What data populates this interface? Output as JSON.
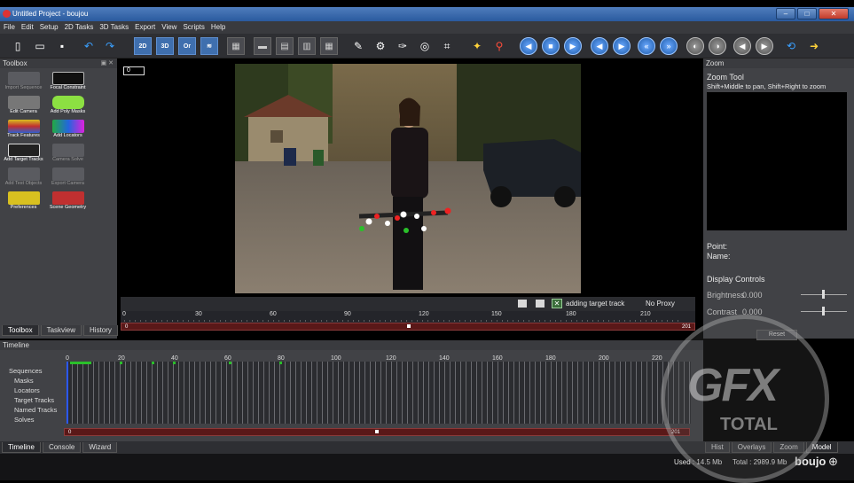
{
  "window": {
    "title": "Untitled Project - boujou"
  },
  "menu": [
    "File",
    "Edit",
    "Setup",
    "2D Tasks",
    "3D Tasks",
    "Export",
    "View",
    "Scripts",
    "Help"
  ],
  "toolbox": {
    "header": "Toolbox",
    "tools": [
      {
        "label": "Import Sequence",
        "enabled": false
      },
      {
        "label": "Focal Constraint",
        "enabled": true
      },
      {
        "label": "Edit Camera",
        "enabled": true
      },
      {
        "label": "Add Poly Masks",
        "enabled": true
      },
      {
        "label": "Track Features",
        "enabled": true
      },
      {
        "label": "Add Locators",
        "enabled": true
      },
      {
        "label": "Add Target Tracks",
        "enabled": true
      },
      {
        "label": "Camera Solve",
        "enabled": false
      },
      {
        "label": "Add Test Objects",
        "enabled": false
      },
      {
        "label": "Export Camera",
        "enabled": false
      },
      {
        "label": "Preferences",
        "enabled": true
      },
      {
        "label": "Scene Geometry",
        "enabled": true
      }
    ],
    "tabs": [
      "Toolbox",
      "Taskview",
      "History"
    ]
  },
  "viewer": {
    "frame": "0",
    "status_text": "adding target track",
    "proxy": "No Proxy",
    "ruler_ticks": [
      "0",
      "30",
      "60",
      "90",
      "120",
      "150",
      "180",
      "210"
    ],
    "range_start": "0",
    "range_end": "201"
  },
  "zoom": {
    "header": "Zoom",
    "title": "Zoom Tool",
    "hint": "Shift+Middle to pan, Shift+Right to zoom",
    "point_label": "Point:",
    "name_label": "Name:",
    "display_controls": "Display Controls",
    "brightness_label": "Brightness",
    "brightness_value": "0.000",
    "contrast_label": "Contrast",
    "contrast_value": "0.000",
    "reset_label": "Reset",
    "tabs": [
      "Hist",
      "Overlays",
      "Zoom",
      "Model"
    ]
  },
  "timeline": {
    "header": "Timeline",
    "tracks": [
      "Sequences",
      "Masks",
      "Locators",
      "Target Tracks",
      "Named Tracks",
      "Solves"
    ],
    "ruler_ticks": [
      "0",
      "20",
      "40",
      "60",
      "80",
      "100",
      "120",
      "140",
      "160",
      "180",
      "200",
      "220"
    ],
    "range_start": "0",
    "range_end": "201",
    "tabs": [
      "Timeline",
      "Console",
      "Wizard"
    ]
  },
  "status": {
    "used": "Used : 14.5 Mb",
    "total": "Total : 2989.9 Mb",
    "brand": "boujo"
  },
  "watermark": {
    "big": "GFX",
    "small": "TOTAL"
  }
}
